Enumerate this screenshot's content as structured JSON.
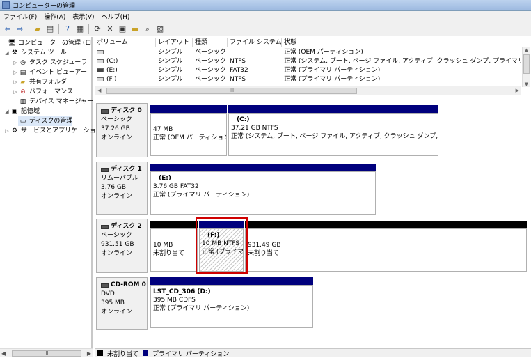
{
  "window": {
    "title": "コンピューターの管理"
  },
  "menu": [
    "ファイル(F)",
    "操作(A)",
    "表示(V)",
    "ヘルプ(H)"
  ],
  "toolbar_icons": [
    "back-arrow-icon",
    "forward-arrow-icon",
    "up-folder-icon",
    "console-tree-icon",
    "help-icon",
    "properties-icon",
    "refresh-icon",
    "delete-icon",
    "settings-icon",
    "open-icon",
    "search-icon",
    "export-icon"
  ],
  "tree": {
    "items": [
      {
        "label": "コンピューターの管理 (ローカ",
        "icon": "computer-manage-icon"
      },
      {
        "label": "システム ツール",
        "icon": "tools-icon"
      },
      {
        "label": "タスク スケジューラ",
        "icon": "clock-icon"
      },
      {
        "label": "イベント ビューアー",
        "icon": "event-icon"
      },
      {
        "label": "共有フォルダー",
        "icon": "folder-icon"
      },
      {
        "label": "パフォーマンス",
        "icon": "performance-icon"
      },
      {
        "label": "デバイス マネージャー",
        "icon": "device-icon"
      },
      {
        "label": "記憶域",
        "icon": "storage-icon"
      },
      {
        "label": "ディスクの管理",
        "icon": "disk-icon"
      },
      {
        "label": "サービスとアプリケーショ",
        "icon": "services-icon"
      }
    ],
    "scroll_label": "III"
  },
  "volumes": {
    "headers": [
      "ボリューム",
      "レイアウト",
      "種類",
      "ファイル システム",
      "状態"
    ],
    "rows": [
      {
        "name": "",
        "layout": "シンプル",
        "type": "ベーシック",
        "fs": "",
        "status": "正常 (OEM パーティション)"
      },
      {
        "name": "(C:)",
        "layout": "シンプル",
        "type": "ベーシック",
        "fs": "NTFS",
        "status": "正常 (システム, ブート, ページ ファイル, アクティブ, クラッシュ ダンプ, プライマリ パ"
      },
      {
        "name": "(E:)",
        "layout": "シンプル",
        "type": "ベーシック",
        "fs": "FAT32",
        "status": "正常 (プライマリ パーティション)"
      },
      {
        "name": "(F:)",
        "layout": "シンプル",
        "type": "ベーシック",
        "fs": "NTFS",
        "status": "正常 (プライマリ パーティション)"
      }
    ],
    "hscroll_label": "III"
  },
  "disks": [
    {
      "name": "ディスク 0",
      "kind": "ベーシック",
      "size": "37.26 GB",
      "state": "オンライン",
      "parts": [
        {
          "title": "",
          "size": "47 MB",
          "status": "正常 (OEM パーティション)"
        },
        {
          "title": "(C:)",
          "size": "37.21 GB NTFS",
          "status": "正常 (システム, ブート, ページ ファイル, アクティブ, クラッシュ ダンプ, プ"
        }
      ]
    },
    {
      "name": "ディスク 1",
      "kind": "リムーバブル",
      "size": "3.76 GB",
      "state": "オンライン",
      "parts": [
        {
          "title": "(E:)",
          "size": "3.76 GB FAT32",
          "status": "正常 (プライマリ パーティション)"
        }
      ]
    },
    {
      "name": "ディスク 2",
      "kind": "ベーシック",
      "size": "931.51 GB",
      "state": "オンライン",
      "parts": [
        {
          "title": "",
          "size": "10 MB",
          "status": "未割り当て"
        },
        {
          "title": "(F:)",
          "size": "10 MB NTFS",
          "status": "正常 (プライマ"
        },
        {
          "title": "",
          "size": "931.49 GB",
          "status": "未割り当て"
        }
      ]
    },
    {
      "name": "CD-ROM 0",
      "kind": "DVD",
      "size": "395 MB",
      "state": "オンライン",
      "parts": [
        {
          "title": "LST_CD_306  (D:)",
          "size": "395 MB CDFS",
          "status": "正常 (プライマリ パーティション)"
        }
      ]
    }
  ],
  "legend": [
    {
      "label": "未割り当て",
      "color": "#000000"
    },
    {
      "label": "プライマリ パーティション",
      "color": "#00007d"
    }
  ]
}
